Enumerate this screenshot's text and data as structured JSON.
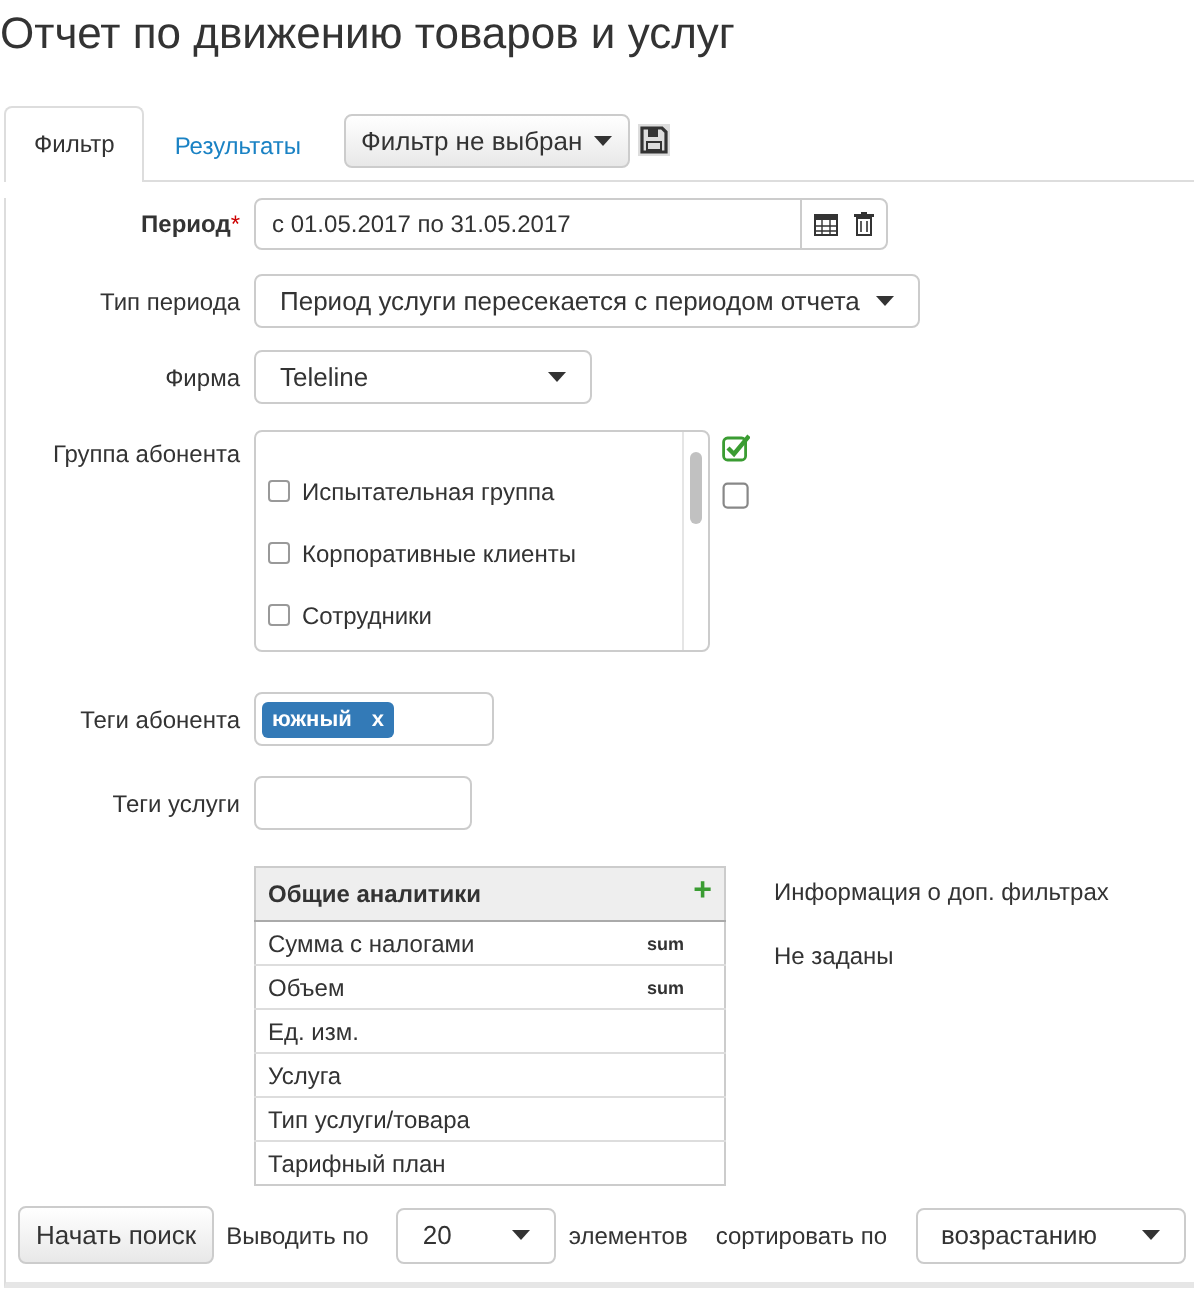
{
  "title": "Отчет по движению товаров и услуг",
  "tabs": [
    {
      "label": "Фильтр",
      "selected": true
    },
    {
      "label": "Результаты",
      "selected": false
    }
  ],
  "filter_select": {
    "value": "Фильтр не выбран"
  },
  "form": {
    "period": {
      "label": "Период",
      "required_mark": "*",
      "value": "с 01.05.2017 по 31.05.2017"
    },
    "period_type": {
      "label": "Тип периода",
      "value": "Период услуги пересекается с периодом отчета"
    },
    "firm": {
      "label": "Фирма",
      "value": "Teleline"
    },
    "subscriber_group": {
      "label": "Группа абонента",
      "items": [
        {
          "label": "Испытательная группа",
          "checked": false
        },
        {
          "label": "Корпоративные клиенты",
          "checked": false
        },
        {
          "label": "Сотрудники",
          "checked": false
        }
      ]
    },
    "subscriber_tags": {
      "label": "Теги абонента",
      "tags": [
        {
          "label": "южный",
          "remove": "x"
        }
      ]
    },
    "service_tags": {
      "label": "Теги услуги"
    }
  },
  "analytics": {
    "title": "Общие аналитики",
    "add": "+",
    "rows": [
      {
        "name": "Сумма с налогами",
        "agg": "sum"
      },
      {
        "name": "Объем",
        "agg": "sum"
      },
      {
        "name": "Ед. изм."
      },
      {
        "name": "Услуга"
      },
      {
        "name": "Тип услуги/товара"
      },
      {
        "name": "Тарифный план"
      }
    ]
  },
  "extra_filters": {
    "title": "Информация о доп. фильтрах",
    "value": "Не заданы"
  },
  "footer": {
    "search_button": "Начать поиск",
    "show_label": "Выводить по",
    "page_size": "20",
    "items_label": "элементов",
    "sort_label": "сортировать по",
    "sort": "возрастанию"
  }
}
